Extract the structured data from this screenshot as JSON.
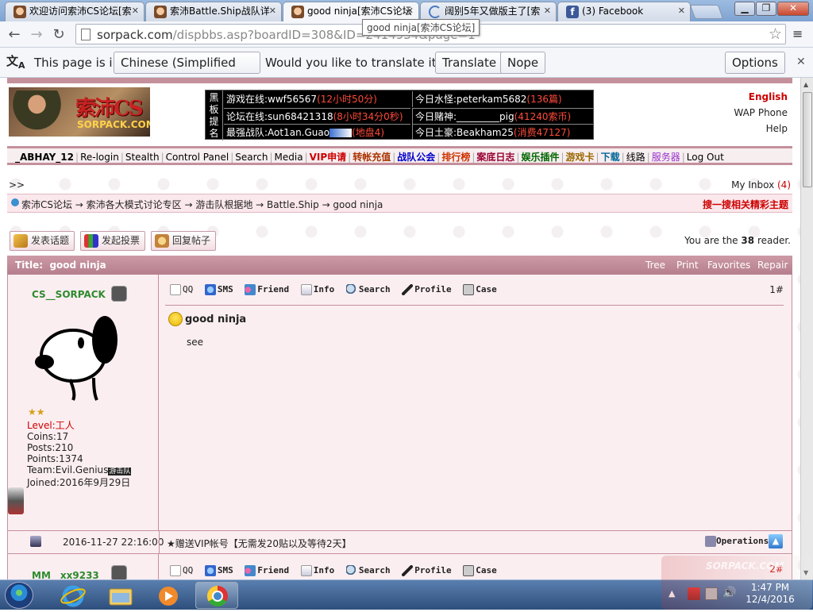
{
  "browser": {
    "tabs": [
      {
        "title": "欢迎访问索沛CS论坛[索",
        "icon": "avatar-face-icon"
      },
      {
        "title": "索沛Battle.Ship战队详",
        "icon": "avatar-face-icon"
      },
      {
        "title": "good ninja[索沛CS论坛",
        "icon": "avatar-face-icon",
        "active": true
      },
      {
        "title": "阔别5年又做版主了[索",
        "icon": "loading-icon"
      },
      {
        "title": "(3) Facebook",
        "icon": "facebook-icon"
      }
    ],
    "url_host": "sorpack.com",
    "url_path": "/dispbbs.asp?boardID=308&ID=2414934&page=1",
    "tooltip": "good ninja[索沛CS论坛]",
    "translate": {
      "prefix": "This page is in",
      "language": "Chinese (Simplified Han)",
      "question": "Would you like to translate it?",
      "translate_btn": "Translate",
      "nope_btn": "Nope",
      "options_btn": "Options"
    }
  },
  "site": {
    "logo_text": "索沛CS",
    "logo_url": "SORPACK.COM",
    "board_side": [
      "黑",
      "板",
      "提",
      "名"
    ],
    "board": [
      {
        "label": "游戏在线:wwf56567",
        "extra": "(12小时50分)"
      },
      {
        "label": "今日水怪:peterkam5682",
        "extra": "(136篇)"
      },
      {
        "label": "论坛在线:sun68421318",
        "extra": "(8小时34分0秒)"
      },
      {
        "label": "今日赌神:_________pig",
        "extra": "(41240索币)"
      },
      {
        "label": "最强战队:Aot1an.Guao",
        "extra": "(地盘4)"
      },
      {
        "label": "今日土豪:Beakham25",
        "extra": "(消费47127)"
      }
    ],
    "right_links": [
      "English",
      "WAP Phone",
      "Help"
    ],
    "nav": [
      {
        "t": "_ABHAY_12",
        "c": "#000",
        "b": true
      },
      {
        "t": "Re-login",
        "c": "#000"
      },
      {
        "t": "Stealth",
        "c": "#000"
      },
      {
        "t": "Control Panel",
        "c": "#000"
      },
      {
        "t": "Search",
        "c": "#000"
      },
      {
        "t": "Media",
        "c": "#000"
      },
      {
        "t": "VIP申请",
        "c": "#cc0000",
        "b": true
      },
      {
        "t": "转帐充值",
        "c": "#aa3300",
        "b": true
      },
      {
        "t": "战队公会",
        "c": "#0000cc",
        "b": true
      },
      {
        "t": "排行榜",
        "c": "#cc3300",
        "b": true
      },
      {
        "t": "案底日志",
        "c": "#990033",
        "b": true
      },
      {
        "t": "娱乐插件",
        "c": "#006600",
        "b": true
      },
      {
        "t": "游戏卡",
        "c": "#996600",
        "b": true
      },
      {
        "t": "下载",
        "c": "#006699",
        "b": true
      },
      {
        "t": "线路",
        "c": "#000"
      },
      {
        "t": "服务器",
        "c": "#9933cc"
      },
      {
        "t": "Log Out",
        "c": "#000"
      }
    ],
    "arrows": ">>",
    "inbox_label": "My Inbox",
    "inbox_count": "(4)",
    "breadcrumb": "索沛CS论坛 → 索沛各大模式讨论专区 → 游击队根据地 → Battle.Ship → good ninja",
    "search_related": "搜一搜相关精彩主题",
    "buttons": [
      "发表话题",
      "发起投票",
      "回复帖子"
    ],
    "reader_prefix": "You are the",
    "reader_count": "38",
    "reader_suffix": "reader.",
    "thread_title_label": "Title:",
    "thread_title": "good ninja",
    "title_actions": [
      "Tree",
      "Print",
      "Favorites",
      "Repair"
    ]
  },
  "post1": {
    "username": "CS__SORPACK",
    "level_label": "Level:",
    "level": "工人",
    "coins": "Coins:17",
    "posts": "Posts:210",
    "points": "Points:1374",
    "team": "Team:Evil.Genius",
    "team_badge": "游击队",
    "joined": "Joined:2016年9月29日",
    "tools": [
      "QQ",
      "SMS",
      "Friend",
      "Info",
      "Search",
      "Profile",
      "Case"
    ],
    "floor": "1#",
    "title": "good ninja",
    "body": "see",
    "datetime": "2016-11-27 22:16:00",
    "signature": "★赠送VIP帐号【无需发20贴以及等待2天】",
    "operations": "Operations"
  },
  "post2": {
    "username": "MM__xx9233",
    "floor": "2#"
  },
  "taskbar": {
    "time": "1:47 PM",
    "date": "12/4/2016",
    "watermark": "SORPACK.COM"
  }
}
